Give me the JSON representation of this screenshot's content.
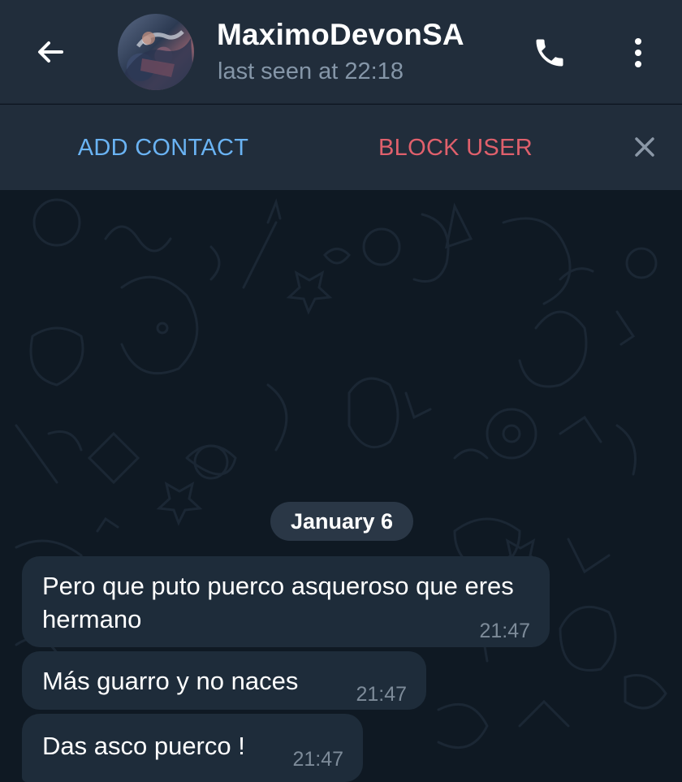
{
  "header": {
    "contact_name": "MaximoDevonSA",
    "status": "last seen at 22:18",
    "icons": [
      "back-arrow-icon",
      "avatar",
      "phone-icon",
      "more-vertical-icon"
    ]
  },
  "action_bar": {
    "add_contact_label": "ADD CONTACT",
    "block_user_label": "BLOCK USER",
    "close_icon": "close-icon"
  },
  "chat": {
    "date_label": "January 6",
    "messages": [
      {
        "text": "Pero que puto puerco asqueroso que eres hermano",
        "time": "21:47"
      },
      {
        "text": "Más guarro y no naces",
        "time": "21:47"
      },
      {
        "text": "Das asco puerco !",
        "time": "21:47"
      }
    ]
  },
  "colors": {
    "header_bg": "#212d3b",
    "chat_bg": "#0e1621",
    "bubble_bg": "#1e2c3a",
    "accent_blue": "#6ab3f3",
    "danger_red": "#e0606c",
    "muted_text": "#8596a8"
  }
}
